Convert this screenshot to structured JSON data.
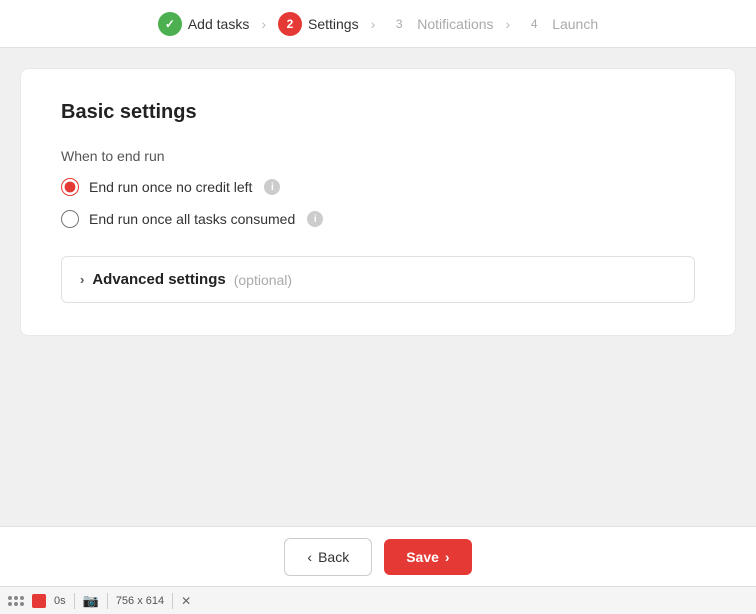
{
  "stepper": {
    "steps": [
      {
        "id": "add-tasks",
        "number": "✓",
        "label": "Add tasks",
        "state": "completed"
      },
      {
        "id": "settings",
        "number": "2",
        "label": "Settings",
        "state": "active"
      },
      {
        "id": "notifications",
        "number": "3",
        "label": "Notifications",
        "state": "inactive"
      },
      {
        "id": "launch",
        "number": "4",
        "label": "Launch",
        "state": "inactive"
      }
    ]
  },
  "card": {
    "title": "Basic settings",
    "when_to_end_label": "When to end run",
    "radio_options": [
      {
        "id": "no-credit",
        "label": "End run once no credit left",
        "checked": true
      },
      {
        "id": "all-tasks",
        "label": "End run once all tasks consumed",
        "checked": false
      }
    ],
    "advanced": {
      "label": "Advanced settings",
      "optional": "(optional)"
    }
  },
  "bottom_bar": {
    "back_label": "Back",
    "save_label": "Save"
  },
  "taskbar": {
    "time": "0s",
    "dimensions": "756 x 614"
  }
}
